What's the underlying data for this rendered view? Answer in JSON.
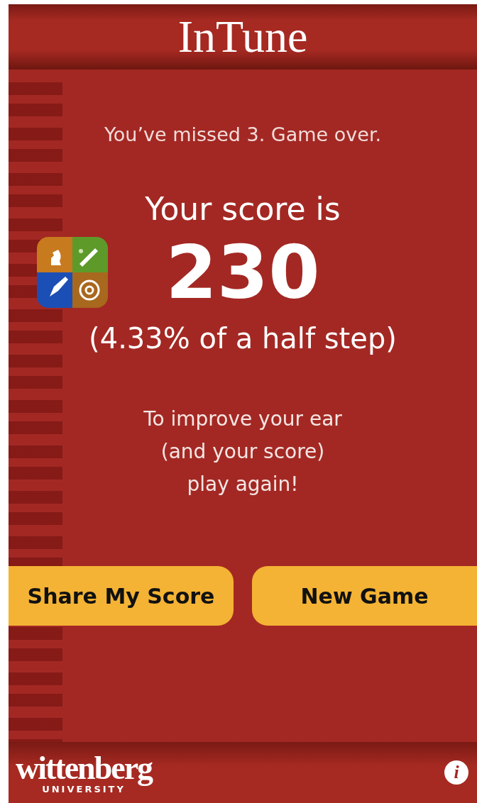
{
  "header": {
    "title": "InTune"
  },
  "result": {
    "message": "You’ve missed 3. Game over.",
    "score_label": "Your score is",
    "score": "230",
    "detail": "(4.33% of a half step)",
    "advice": [
      "To improve your ear",
      "(and your score)",
      "play again!"
    ]
  },
  "buttons": [
    {
      "label": "Share My Score"
    },
    {
      "label": "New Game"
    }
  ],
  "footer": {
    "logo": "wittenberg",
    "logo_sub": "UNIVERSITY",
    "info": "i"
  }
}
